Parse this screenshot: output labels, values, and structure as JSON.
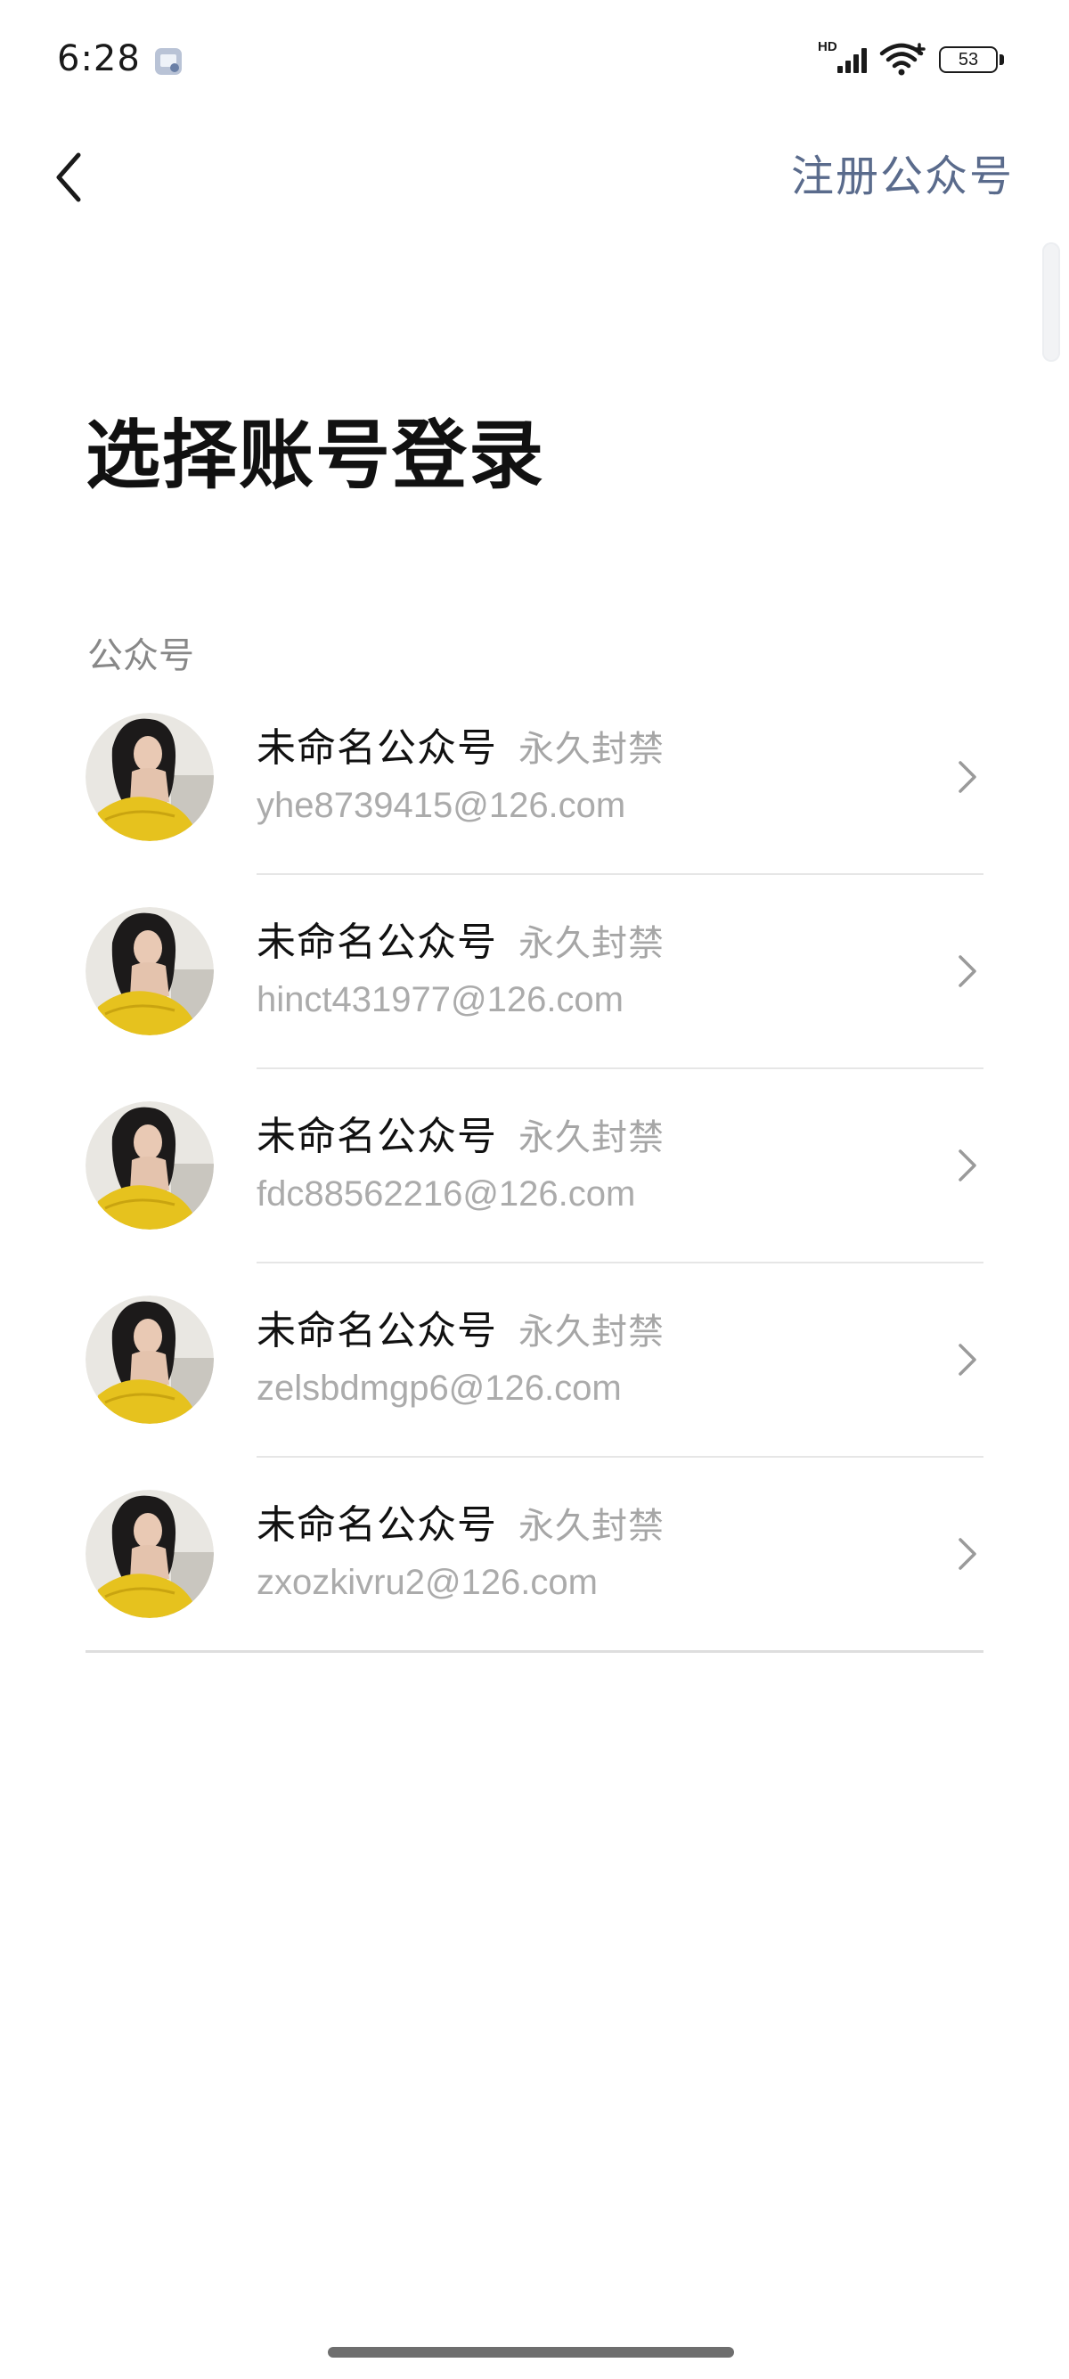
{
  "status_bar": {
    "time": "6:28",
    "network_label": "HD",
    "battery_level": "53",
    "app_icon": "app-notification-icon",
    "signal_icon": "cellular-signal-icon",
    "wifi_icon": "wifi-icon",
    "battery_icon": "battery-icon"
  },
  "nav": {
    "back_icon": "back-chevron-icon",
    "register_label": "注册公众号"
  },
  "page": {
    "title": "选择账号登录",
    "section_label": "公众号"
  },
  "accounts": [
    {
      "name": "未命名公众号",
      "status": "永久封禁",
      "email": "yhe8739415@126.com"
    },
    {
      "name": "未命名公众号",
      "status": "永久封禁",
      "email": "hinct431977@126.com"
    },
    {
      "name": "未命名公众号",
      "status": "永久封禁",
      "email": "fdc88562216@126.com"
    },
    {
      "name": "未命名公众号",
      "status": "永久封禁",
      "email": "zelsbdmgp6@126.com"
    },
    {
      "name": "未命名公众号",
      "status": "永久封禁",
      "email": "zxozkivru2@126.com"
    }
  ],
  "colors": {
    "accent_link": "#5a6b8c",
    "muted_text": "#ababab",
    "avatar_dress": "#e6c21e"
  }
}
